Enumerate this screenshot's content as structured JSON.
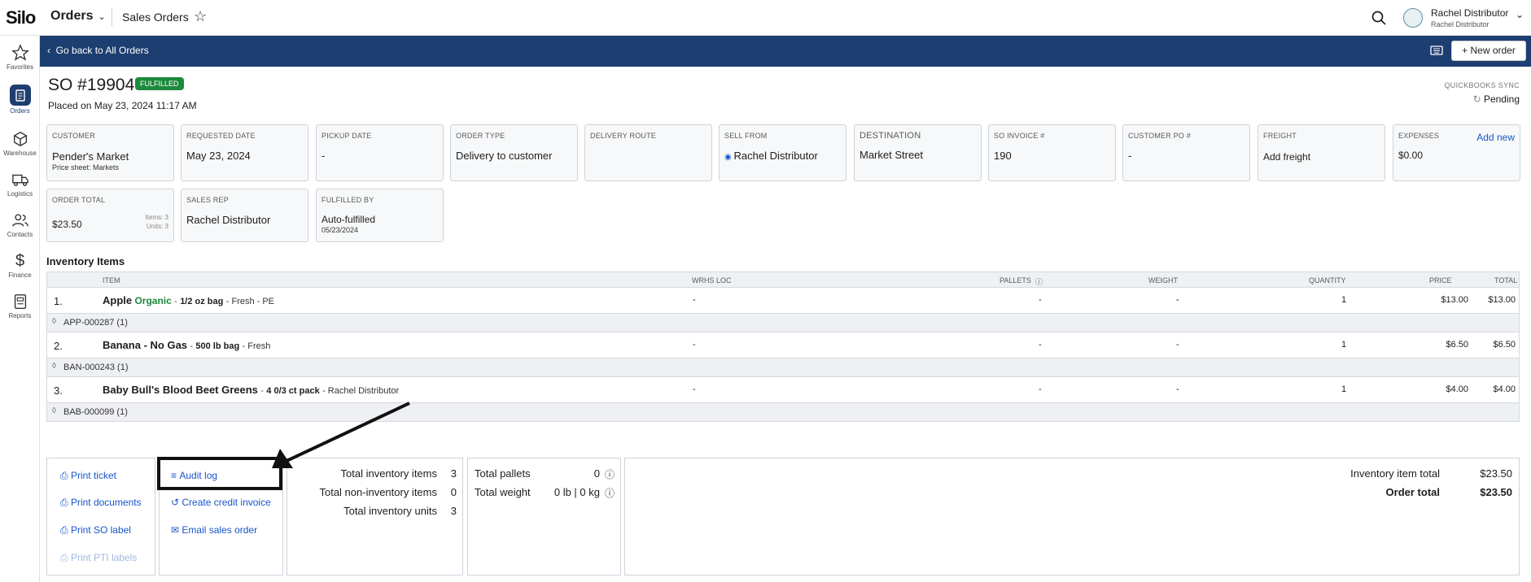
{
  "app": {
    "logo": "Silo",
    "menu": "Orders",
    "breadcrumb": "Sales Orders"
  },
  "user": {
    "name": "Rachel Distributor",
    "sub": "Rachel Distributor"
  },
  "sidebar": [
    {
      "label": "Favorites",
      "icon": "star-icon"
    },
    {
      "label": "Orders",
      "icon": "clipboard-icon"
    },
    {
      "label": "Warehouse",
      "icon": "box-icon"
    },
    {
      "label": "Logistics",
      "icon": "truck-icon"
    },
    {
      "label": "Contacts",
      "icon": "users-icon"
    },
    {
      "label": "Finance",
      "icon": "dollar-icon"
    },
    {
      "label": "Reports",
      "icon": "report-icon"
    }
  ],
  "bluebar": {
    "back": "Go back to All Orders",
    "new_order": "New order"
  },
  "order": {
    "title": "SO #19904",
    "status": "FULFILLED",
    "placed": "Placed on May 23, 2024 11:17 AM",
    "qb_label": "QUICKBOOKS SYNC",
    "qb_status": "Pending"
  },
  "cards": {
    "customer": {
      "label": "CUSTOMER",
      "value": "Pender's Market",
      "sub": "Price sheet: Markets"
    },
    "requested": {
      "label": "REQUESTED DATE",
      "value": "May 23, 2024"
    },
    "pickup": {
      "label": "PICKUP DATE",
      "value": "-"
    },
    "order_type": {
      "label": "ORDER TYPE",
      "value": "Delivery to customer"
    },
    "route": {
      "label": "DELIVERY ROUTE",
      "value": ""
    },
    "sell_from": {
      "label": "SELL FROM",
      "value": "Rachel Distributor"
    },
    "destination": {
      "label": "DESTINATION",
      "value": "Market Street"
    },
    "invoice": {
      "label": "SO INVOICE #",
      "value": "190"
    },
    "po": {
      "label": "CUSTOMER PO #",
      "value": "-"
    },
    "freight": {
      "label": "FREIGHT",
      "value": "Add freight"
    },
    "expenses": {
      "label": "EXPENSES",
      "value": "$0.00",
      "action": "Add new"
    },
    "total": {
      "label": "ORDER TOTAL",
      "value": "$23.50",
      "items": "Items: 3",
      "units": "Units: 3"
    },
    "sales_rep": {
      "label": "SALES REP",
      "value": "Rachel Distributor"
    },
    "fulfilled": {
      "label": "FULFILLED BY",
      "value": "Auto-fulfilled",
      "sub": "05/23/2024"
    }
  },
  "inventory": {
    "title": "Inventory Items",
    "headers": {
      "item": "ITEM",
      "wrhs": "WRHS LOC",
      "pallets": "PALLETS",
      "weight": "WEIGHT",
      "qty": "QUANTITY",
      "price": "PRICE",
      "total": "TOTAL"
    },
    "rows": [
      {
        "n": "1.",
        "name": "Apple",
        "organic": "Organic",
        "pack": "1/2 oz bag",
        "meta": "- Fresh - PE",
        "wrhs": "-",
        "pallets": "-",
        "weight": "-",
        "qty": "1",
        "price": "$13.00",
        "total": "$13.00",
        "lot": "APP-000287 (1)"
      },
      {
        "n": "2.",
        "name": "Banana - No Gas",
        "organic": "",
        "pack": "500 lb bag",
        "meta": "- Fresh",
        "wrhs": "-",
        "pallets": "-",
        "weight": "-",
        "qty": "1",
        "price": "$6.50",
        "total": "$6.50",
        "lot": "BAN-000243 (1)"
      },
      {
        "n": "3.",
        "name": "Baby Bull's Blood Beet Greens",
        "organic": "",
        "pack": "4 0/3 ct pack",
        "meta": "- Rachel Distributor",
        "wrhs": "-",
        "pallets": "-",
        "weight": "-",
        "qty": "1",
        "price": "$4.00",
        "total": "$4.00",
        "lot": "BAB-000099 (1)"
      }
    ]
  },
  "actions": {
    "print_ticket": "Print ticket",
    "print_documents": "Print documents",
    "print_so_label": "Print SO label",
    "print_pti": "Print PTI labels",
    "audit_log": "Audit log",
    "credit_invoice": "Create credit invoice",
    "email": "Email sales order"
  },
  "stats": {
    "inv_items_label": "Total inventory items",
    "inv_items": "3",
    "non_inv_label": "Total non-inventory items",
    "non_inv": "0",
    "units_label": "Total inventory units",
    "units": "3",
    "pallets_label": "Total pallets",
    "pallets": "0",
    "weight_label": "Total weight",
    "weight": "0 lb | 0 kg"
  },
  "totals": {
    "inv_total_label": "Inventory item total",
    "inv_total": "$23.50",
    "order_total_label": "Order total",
    "order_total": "$23.50"
  }
}
